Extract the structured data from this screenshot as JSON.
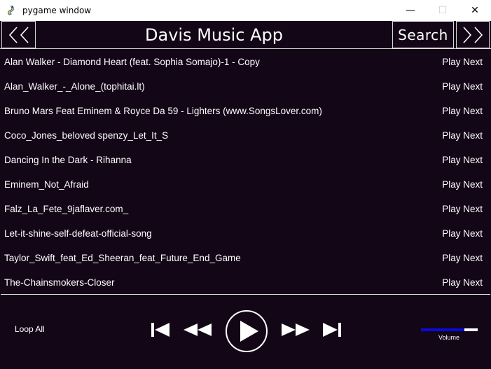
{
  "window": {
    "title": "pygame window",
    "controls": {
      "minimize": "—",
      "maximize": "☐",
      "close": "✕"
    }
  },
  "header": {
    "app_title": "Davis Music App",
    "search_label": "Search",
    "prev_label": "<<",
    "next_label": ">>"
  },
  "songs": [
    {
      "title": "Alan Walker - Diamond Heart (feat. Sophia Somajo)-1 - Copy",
      "action": "Play Next"
    },
    {
      "title": "Alan_Walker_-_Alone_(tophitai.lt)",
      "action": "Play Next"
    },
    {
      "title": "Bruno Mars Feat Eminem & Royce Da 59 - Lighters (www.SongsLover.com)",
      "action": "Play Next"
    },
    {
      "title": "Coco_Jones_beloved spenzy_Let_It_S",
      "action": "Play Next"
    },
    {
      "title": "Dancing In the Dark - Rihanna",
      "action": "Play Next"
    },
    {
      "title": "Eminem_Not_Afraid",
      "action": "Play Next"
    },
    {
      "title": "Falz_La_Fete_9jaflaver.com_",
      "action": "Play Next"
    },
    {
      "title": "Let-it-shine-self-defeat-official-song",
      "action": "Play Next"
    },
    {
      "title": "Taylor_Swift_feat_Ed_Sheeran_feat_Future_End_Game",
      "action": "Play Next"
    },
    {
      "title": "The-Chainsmokers-Closer",
      "action": "Play Next"
    }
  ],
  "controls": {
    "loop_label": "Loop All",
    "icons": [
      "skip-previous-icon",
      "rewind-icon",
      "play-icon",
      "fast-forward-icon",
      "skip-next-icon"
    ],
    "volume_label": "Volume",
    "volume_level": 0.77
  },
  "colors": {
    "background": "#130617",
    "text": "#ffffff",
    "border": "#d8d8d8",
    "volume_fill": "#0a0ad8"
  }
}
